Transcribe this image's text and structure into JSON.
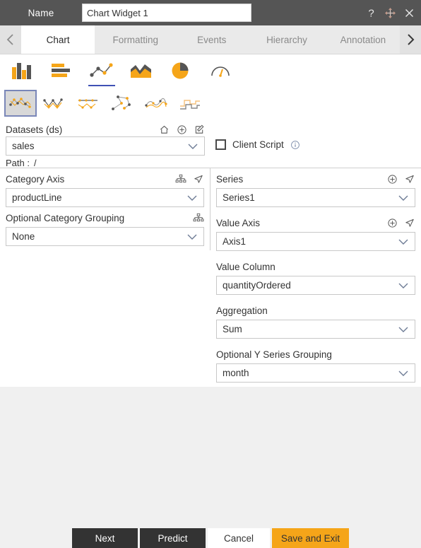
{
  "window": {
    "name_label": "Name",
    "widget_name": "Chart Widget 1",
    "controls": [
      {
        "icon": "help-icon",
        "glyph": "?"
      },
      {
        "icon": "move-icon",
        "glyph": "move"
      },
      {
        "icon": "close-icon",
        "glyph": "x"
      }
    ]
  },
  "tabs": {
    "prev_label": "‹",
    "next_label": "›",
    "items": [
      {
        "label": "Chart",
        "active": true
      },
      {
        "label": "Formatting",
        "active": false
      },
      {
        "label": "Events",
        "active": false
      },
      {
        "label": "Hierarchy",
        "active": false
      },
      {
        "label": "Annotation",
        "active": false
      }
    ]
  },
  "chart_types": [
    {
      "name": "column-chart-icon",
      "selected": false
    },
    {
      "name": "bar-chart-icon",
      "selected": false
    },
    {
      "name": "line-scatter-chart-icon",
      "selected": true
    },
    {
      "name": "area-chart-icon",
      "selected": false
    },
    {
      "name": "pie-chart-icon",
      "selected": false
    },
    {
      "name": "gauge-chart-icon",
      "selected": false
    }
  ],
  "chart_subtypes": [
    {
      "name": "line-marker-chart-icon",
      "selected": true
    },
    {
      "name": "line-zigzag-chart-icon",
      "selected": false
    },
    {
      "name": "line-range-chart-icon",
      "selected": false
    },
    {
      "name": "scatter-chart-icon",
      "selected": false
    },
    {
      "name": "line-smooth-chart-icon",
      "selected": false
    },
    {
      "name": "step-line-chart-icon",
      "selected": false
    }
  ],
  "datasets": {
    "label": "Datasets (ds)",
    "icons": [
      "home-icon",
      "add-circle-icon",
      "edit-icon"
    ],
    "value": "sales",
    "path_label": "Path :",
    "path_value": "/"
  },
  "client_script": {
    "label": "Client Script",
    "checked": false,
    "info_icon": "info-icon"
  },
  "left_panel": {
    "category_axis": {
      "label": "Category Axis",
      "icons": [
        "hierarchy-icon",
        "cursor-icon"
      ],
      "value": "productLine"
    },
    "category_grouping": {
      "label": "Optional Category Grouping",
      "icons": [
        "hierarchy-icon"
      ],
      "value": "None"
    }
  },
  "right_panel": {
    "series": {
      "label": "Series",
      "icons": [
        "add-circle-icon",
        "cursor-icon"
      ],
      "value": "Series1"
    },
    "value_axis": {
      "label": "Value Axis",
      "icons": [
        "add-circle-icon",
        "cursor-icon"
      ],
      "value": "Axis1"
    },
    "value_column": {
      "label": "Value Column",
      "value": "quantityOrdered"
    },
    "aggregation": {
      "label": "Aggregation",
      "value": "Sum"
    },
    "y_series_grouping": {
      "label": "Optional Y Series Grouping",
      "value": "month"
    }
  },
  "footer": {
    "next": "Next",
    "predict": "Predict",
    "cancel": "Cancel",
    "save_exit": "Save and Exit"
  },
  "colors": {
    "titlebar": "#555555",
    "accent_amber": "#f5a519",
    "accent_blue": "#3f51b5",
    "dark_button": "#333333",
    "page_bg": "#f0f0f0"
  }
}
